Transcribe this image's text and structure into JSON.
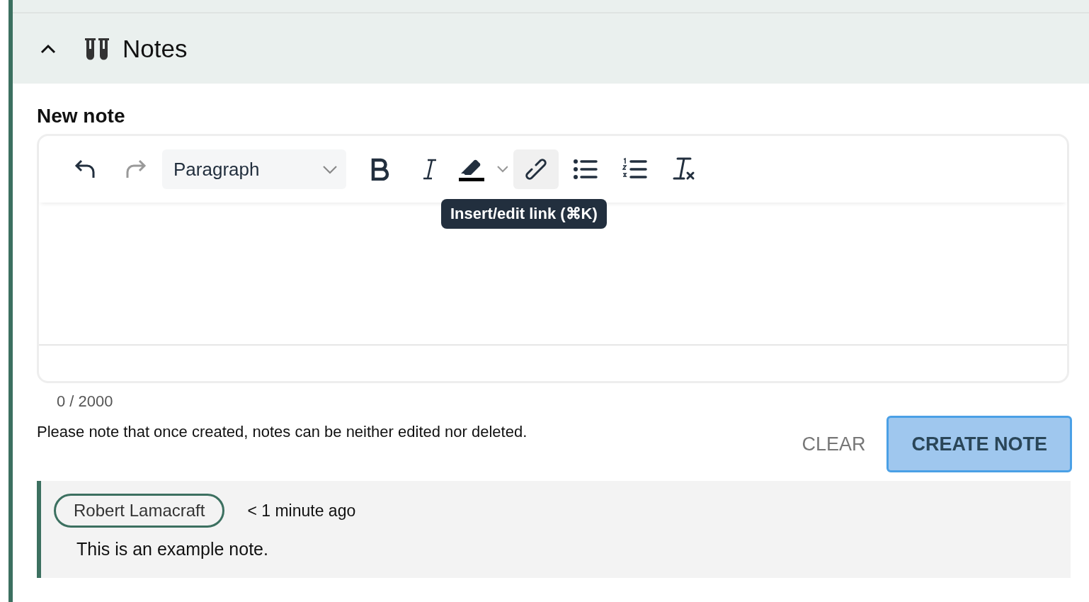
{
  "section": {
    "title": "Notes",
    "expanded": true
  },
  "new_note": {
    "label": "New note",
    "toolbar": [
      {
        "kind": "undo",
        "disabled": false,
        "active": false
      },
      {
        "kind": "redo",
        "disabled": true,
        "active": false
      },
      {
        "kind": "format",
        "value": "Paragraph"
      },
      {
        "kind": "bold",
        "disabled": false,
        "active": false
      },
      {
        "kind": "italic",
        "disabled": false,
        "active": false
      },
      {
        "kind": "highlight",
        "disabled": false,
        "active": false
      },
      {
        "kind": "link",
        "disabled": false,
        "active": true
      },
      {
        "kind": "bullets",
        "disabled": false,
        "active": false
      },
      {
        "kind": "numbers",
        "disabled": false,
        "active": false
      },
      {
        "kind": "clear-format",
        "disabled": false,
        "active": false
      }
    ],
    "tooltip": "Insert/edit link (⌘K)",
    "counter": "0 / 2000",
    "notice": "Please note that once created, notes can be neither edited nor deleted.",
    "buttons": [
      {
        "kind": "text",
        "label": "CLEAR"
      },
      {
        "kind": "primary",
        "label": "CREATE NOTE"
      }
    ]
  },
  "notes": [
    {
      "author": "Robert Lamacraft",
      "time": "< 1 minute ago",
      "text": "This is an example note."
    }
  ]
}
